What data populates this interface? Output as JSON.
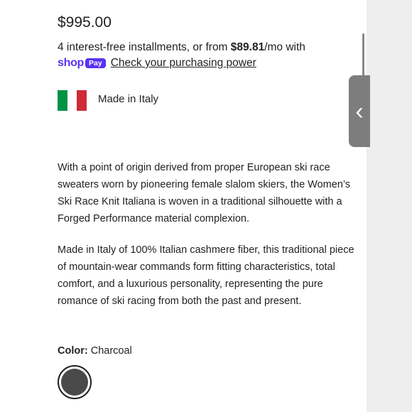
{
  "product": {
    "price": "$995.00"
  },
  "installments": {
    "prefix": "4 interest-free installments, or from ",
    "amount": "$89.81",
    "suffix": "/mo with",
    "shop_word": "shop",
    "pay_badge": "Pay",
    "check_link": "Check your purchasing power"
  },
  "origin": {
    "flag_colors": [
      "#009246",
      "#ffffff",
      "#ce2b37"
    ],
    "label": "Made in Italy"
  },
  "description": {
    "paragraph_1": "With a point of origin derived from proper European ski race sweaters worn by pioneering female slalom skiers, the Women’s Ski Race Knit Italiana is woven in a traditional silhouette with a Forged Performance material complexion.",
    "paragraph_2": "Made in Italy of 100% Italian cashmere fiber, this traditional piece of mountain-wear commands form fitting characteristics, total comfort, and a luxurious personality, representing the pure romance of ski racing from both the past and present."
  },
  "color": {
    "label": "Color:",
    "value": "Charcoal",
    "swatch_hex": "#4a4a4a"
  },
  "side_tab": {
    "icon": "chevron-left-icon",
    "glyph": "‹"
  },
  "brand_colors": {
    "shop_pay": "#5a31f4"
  }
}
